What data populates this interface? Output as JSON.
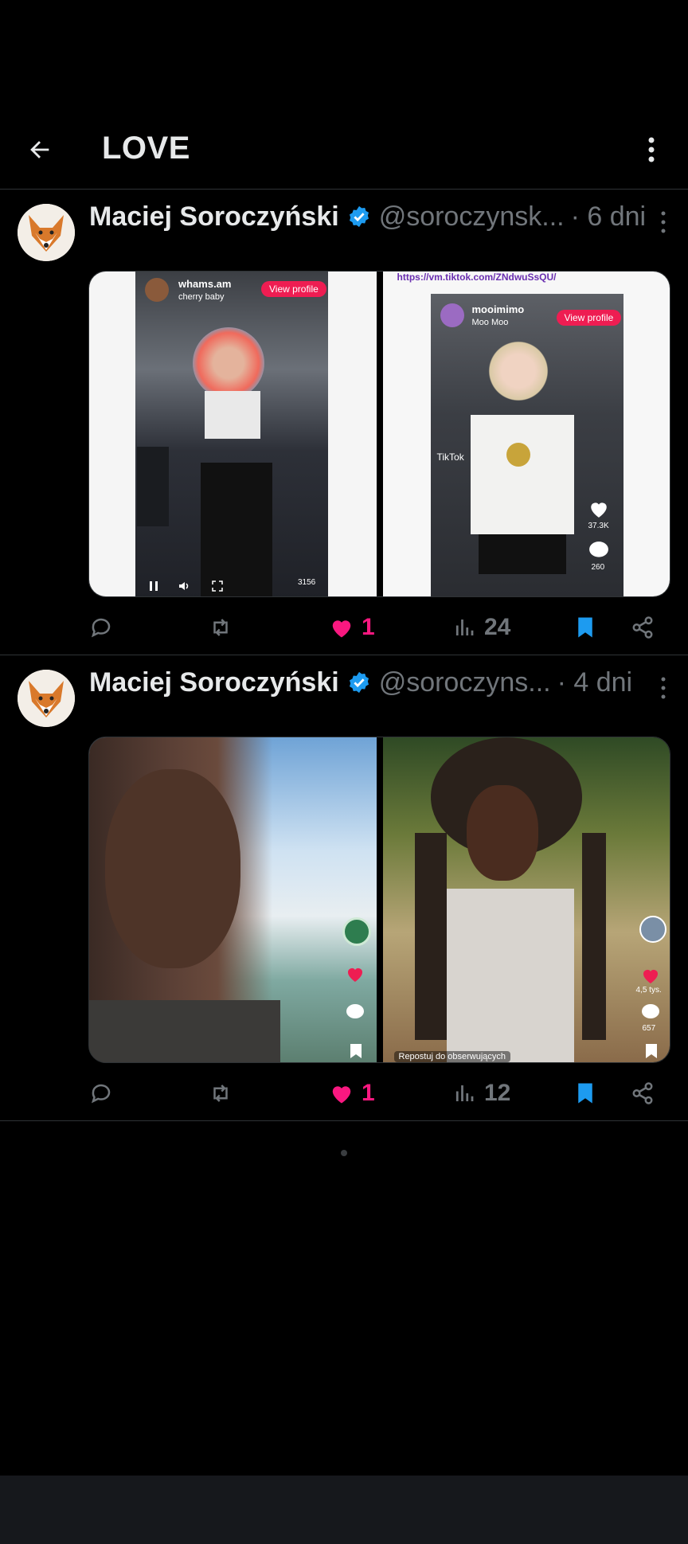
{
  "header": {
    "title": "LOVE",
    "back_icon": "arrow-left-icon",
    "more_icon": "more-vertical-icon"
  },
  "posts": [
    {
      "author": "Maciej Soroczyński",
      "handle": "@soroczynsk...",
      "time": "· 6 dni",
      "media": [
        {
          "username": "whams.am",
          "caption": "cherry baby",
          "button": "View profile",
          "count_a": "3156"
        },
        {
          "link": "https://vm.tiktok.com/ZNdwuSsQU/",
          "username": "mooimimo",
          "caption": "Moo Moo",
          "button": "View profile",
          "likes": "37.3K",
          "comments": "260",
          "brand": "TikTok"
        }
      ],
      "actions": {
        "likes": "1",
        "views": "24"
      }
    },
    {
      "author": "Maciej Soroczyński",
      "handle": "@soroczyns...",
      "time": "· 4 dni",
      "media": [
        {
          "likes": "",
          "comments": ""
        },
        {
          "likes": "4,5 tys.",
          "comments": "657",
          "repost": "Repostuj do obserwujących"
        }
      ],
      "actions": {
        "likes": "1",
        "views": "12"
      }
    }
  ],
  "colors": {
    "like": "#f91880",
    "verified": "#1d9bf0",
    "bookmark": "#1d9bf0",
    "muted": "#71767b"
  }
}
